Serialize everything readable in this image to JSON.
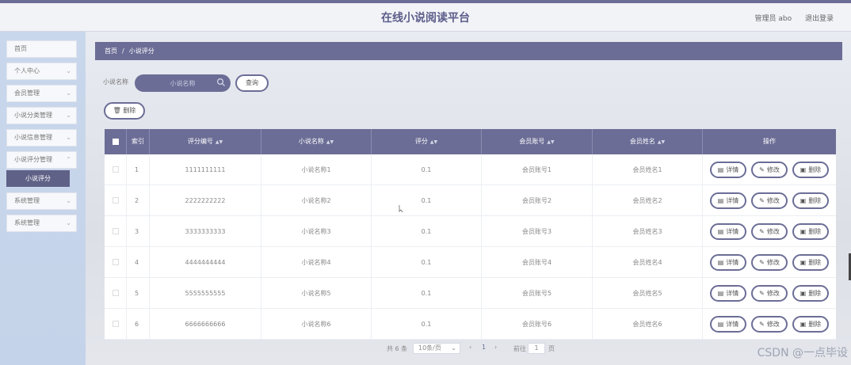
{
  "header": {
    "title": "在线小说阅读平台",
    "user": "管理员 abo",
    "logout": "退出登录"
  },
  "sidebar": {
    "items": [
      {
        "label": "首页",
        "chevron": false
      },
      {
        "label": "个人中心",
        "chevron": true
      },
      {
        "label": "会员管理",
        "chevron": true
      },
      {
        "label": "小说分类管理",
        "chevron": true
      },
      {
        "label": "小说信息管理",
        "chevron": true
      },
      {
        "label": "小说评分管理",
        "chevron": true
      },
      {
        "label": "系统管理",
        "chevron": true
      },
      {
        "label": "系统管理",
        "chevron": true
      }
    ],
    "active_submenu": "小说评分"
  },
  "breadcrumb": {
    "home": "首页",
    "separator": "/",
    "current": "小说评分"
  },
  "search": {
    "label": "小说名称",
    "placeholder": "小说名称",
    "query_button": "查询"
  },
  "toolbar": {
    "delete_button": "删除"
  },
  "table": {
    "columns": [
      "索引",
      "评分编号",
      "小说名称",
      "评分",
      "会员账号",
      "会员姓名",
      "操作"
    ],
    "rows": [
      {
        "index": "1",
        "rating_no": "1111111111",
        "novel_name": "小说名称1",
        "score": "0.1",
        "member_account": "会员账号1",
        "member_name": "会员姓名1"
      },
      {
        "index": "2",
        "rating_no": "2222222222",
        "novel_name": "小说名称2",
        "score": "0.1",
        "member_account": "会员账号2",
        "member_name": "会员姓名2"
      },
      {
        "index": "3",
        "rating_no": "3333333333",
        "novel_name": "小说名称3",
        "score": "0.1",
        "member_account": "会员账号3",
        "member_name": "会员姓名3"
      },
      {
        "index": "4",
        "rating_no": "4444444444",
        "novel_name": "小说名称4",
        "score": "0.1",
        "member_account": "会员账号4",
        "member_name": "会员姓名4"
      },
      {
        "index": "5",
        "rating_no": "5555555555",
        "novel_name": "小说名称5",
        "score": "0.1",
        "member_account": "会员账号5",
        "member_name": "会员姓名5"
      },
      {
        "index": "6",
        "rating_no": "6666666666",
        "novel_name": "小说名称6",
        "score": "0.1",
        "member_account": "会员账号6",
        "member_name": "会员姓名6"
      }
    ],
    "actions": {
      "detail": "详情",
      "edit": "修改",
      "delete": "删除"
    }
  },
  "pagination": {
    "total": "共 6 条",
    "page_size": "10条/页",
    "prev": "‹",
    "current_page": "1",
    "next": "›",
    "goto_label": "前往",
    "goto_value": "1",
    "goto_suffix": "页"
  },
  "watermark": "CSDN @一点毕设",
  "colors": {
    "accent": "#6b6d96",
    "sidebar_bg": "#c9d7ec",
    "page_bg": "#dfe3ea"
  }
}
